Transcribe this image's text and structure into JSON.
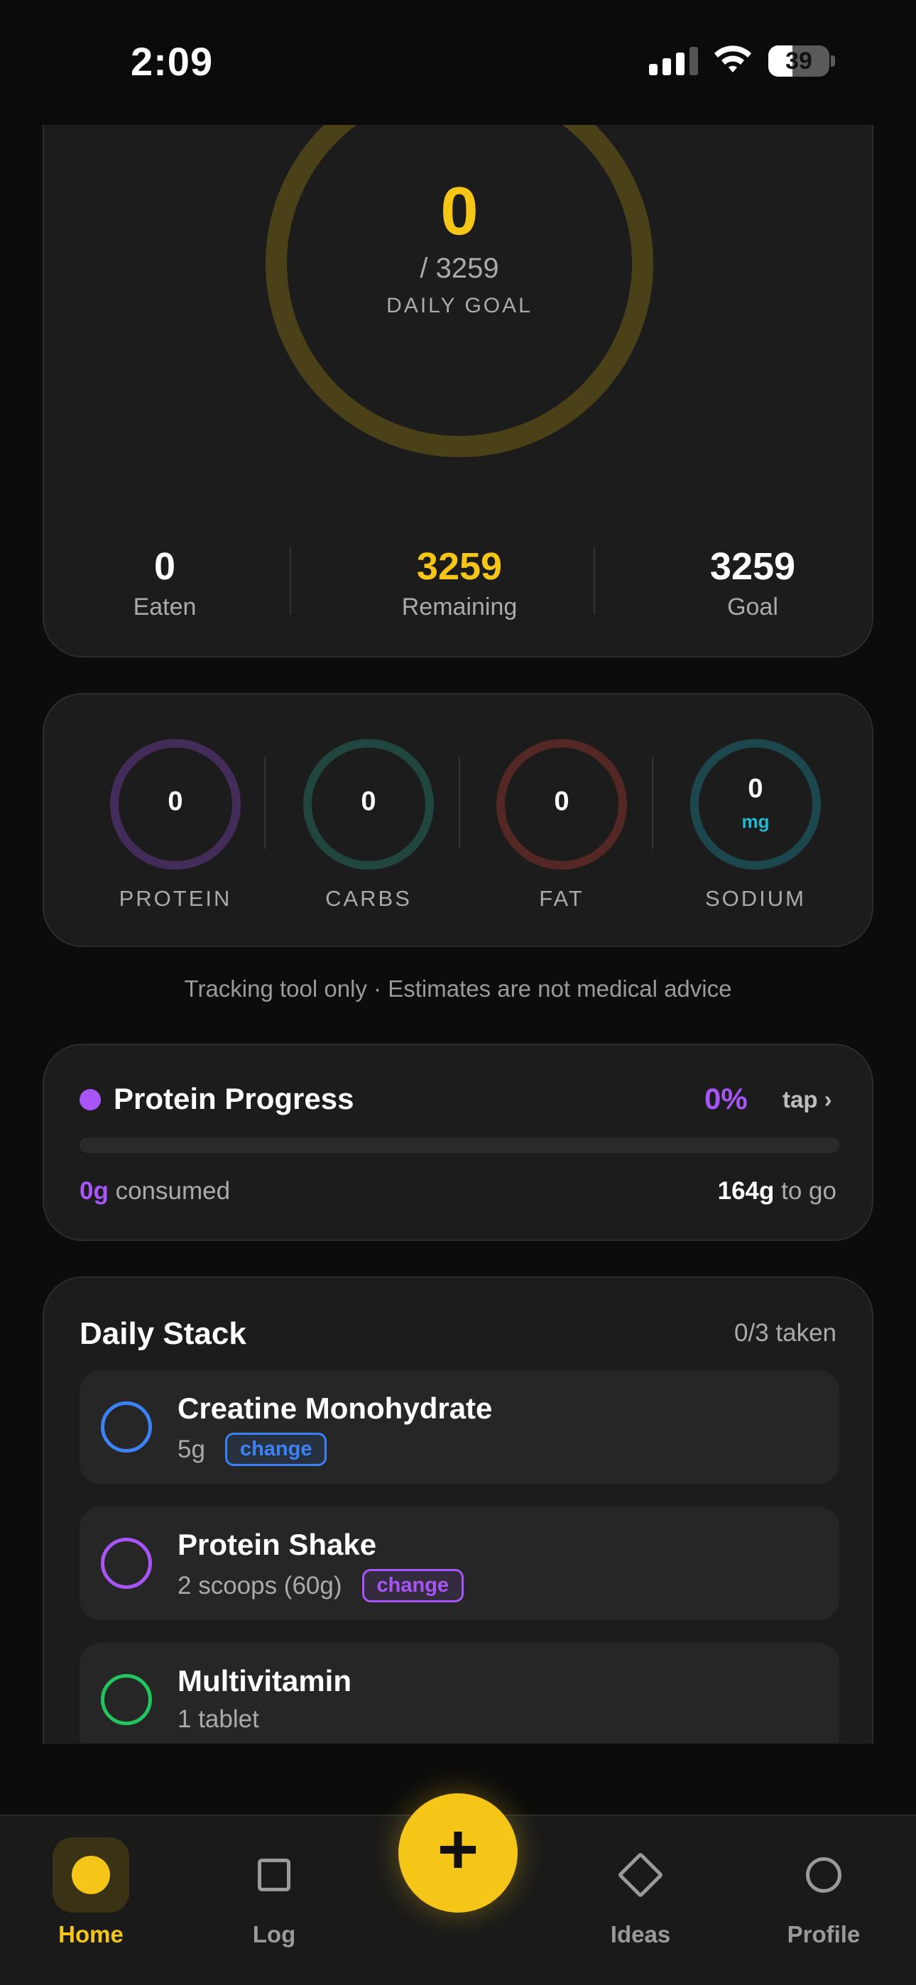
{
  "status_bar": {
    "time": "2:09",
    "battery_level": "39"
  },
  "calories": {
    "value": "0",
    "goal_text": "/ 3259",
    "goal_label": "DAILY GOAL",
    "progress_fraction": 0,
    "ring_color": "#f5c518",
    "stats": [
      {
        "value": "0",
        "label": "Eaten",
        "color": "#ffffff"
      },
      {
        "value": "3259",
        "label": "Remaining",
        "color": "#f5c518"
      },
      {
        "value": "3259",
        "label": "Goal",
        "color": "#ffffff"
      }
    ]
  },
  "macros": [
    {
      "value": "0",
      "unit": "",
      "label": "PROTEIN",
      "color": "#a855f7"
    },
    {
      "value": "0",
      "unit": "",
      "label": "CARBS",
      "color": "#2bb59a"
    },
    {
      "value": "0",
      "unit": "",
      "label": "FAT",
      "color": "#e0463b"
    },
    {
      "value": "0",
      "unit": "mg",
      "label": "SODIUM",
      "color": "#22b8cf"
    }
  ],
  "disclaimer": "Tracking tool only · Estimates are not medical advice",
  "protein_progress": {
    "title": "Protein Progress",
    "percent": "0%",
    "tap_label": "tap ›",
    "progress_fraction": 0,
    "consumed_value": "0g",
    "consumed_label": "consumed",
    "togo_value": "164g",
    "togo_label": "to go",
    "color": "#a855f7"
  },
  "daily_stack": {
    "title": "Daily Stack",
    "count": "0/3 taken",
    "items": [
      {
        "name": "Creatine Monohydrate",
        "dose": "5g",
        "change_label": "change",
        "color": "#3b82f6"
      },
      {
        "name": "Protein Shake",
        "dose": "2 scoops (60g)",
        "change_label": "change",
        "color": "#a855f7"
      },
      {
        "name": "Multivitamin",
        "dose": "1 tablet",
        "change_label": "",
        "color": "#22c55e"
      }
    ]
  },
  "nav": {
    "items": [
      {
        "label": "Home",
        "icon": "home-dot-icon",
        "active": true
      },
      {
        "label": "Log",
        "icon": "square-icon",
        "active": false
      },
      {
        "label": "Ideas",
        "icon": "diamond-icon",
        "active": false
      },
      {
        "label": "Profile",
        "icon": "circle-icon",
        "active": false
      }
    ],
    "fab_glyph": "+",
    "accent": "#f5c518"
  }
}
